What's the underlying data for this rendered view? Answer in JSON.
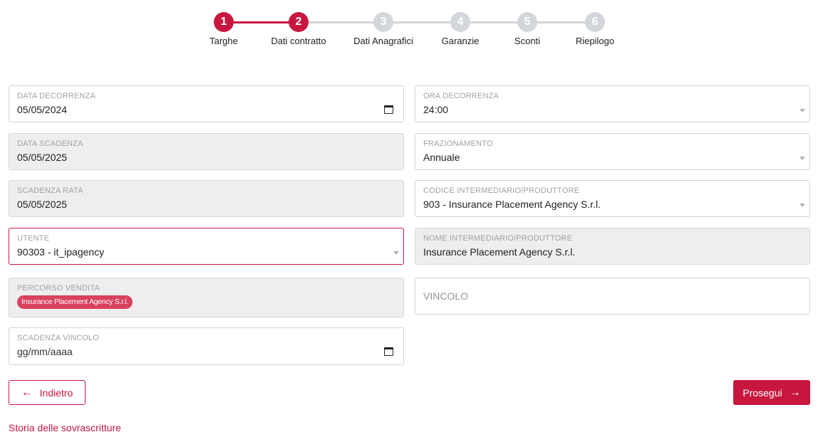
{
  "stepper": {
    "steps": [
      {
        "number": "1",
        "label": "Targhe",
        "state": "done"
      },
      {
        "number": "2",
        "label": "Dati contratto",
        "state": "current"
      },
      {
        "number": "3",
        "label": "Dati Anagrafici",
        "state": "pending"
      },
      {
        "number": "4",
        "label": "Garanzie",
        "state": "pending"
      },
      {
        "number": "5",
        "label": "Sconti",
        "state": "pending"
      },
      {
        "number": "6",
        "label": "Riepilogo",
        "state": "pending"
      }
    ]
  },
  "form": {
    "data_decorrenza": {
      "label": "DATA DECORRENZA",
      "value": "05/05/2024"
    },
    "ora_decorrenza": {
      "label": "ORA DECORRENZA",
      "value": "24:00"
    },
    "data_scadenza": {
      "label": "DATA SCADENZA",
      "value": "05/05/2025"
    },
    "frazionamento": {
      "label": "FRAZIONAMENTO",
      "value": "Annuale"
    },
    "scadenza_rata": {
      "label": "SCADENZA RATA",
      "value": "05/05/2025"
    },
    "codice_intermediario": {
      "label": "CODICE INTERMEDIARIO/PRODUTTORE",
      "value": "903 - Insurance Placement Agency S.r.l."
    },
    "utente": {
      "label": "UTENTE",
      "value": "90303 - it_ipagency"
    },
    "nome_intermediario": {
      "label": "NOME INTERMEDIARIO/PRODUTTORE",
      "value": "Insurance Placement Agency S.r.l."
    },
    "percorso_vendita": {
      "label": "PERCORSO VENDITA",
      "chip": "Insurance Placement Agency S.r.l."
    },
    "vincolo": {
      "label": "VINCOLO"
    },
    "scadenza_vincolo": {
      "label": "SCADENZA VINCOLO",
      "placeholder": "gg/mm/aaaa"
    }
  },
  "actions": {
    "back_label": "Indietro",
    "back_icon": "arrow-left-icon",
    "next_label": "Prosegui",
    "next_icon": "arrow-right-icon",
    "history_link": "Storia delle sovrascritture"
  },
  "colors": {
    "accent": "#c8173f",
    "step_inactive": "#d3d6db",
    "disabled_bg": "#eeeeee"
  }
}
